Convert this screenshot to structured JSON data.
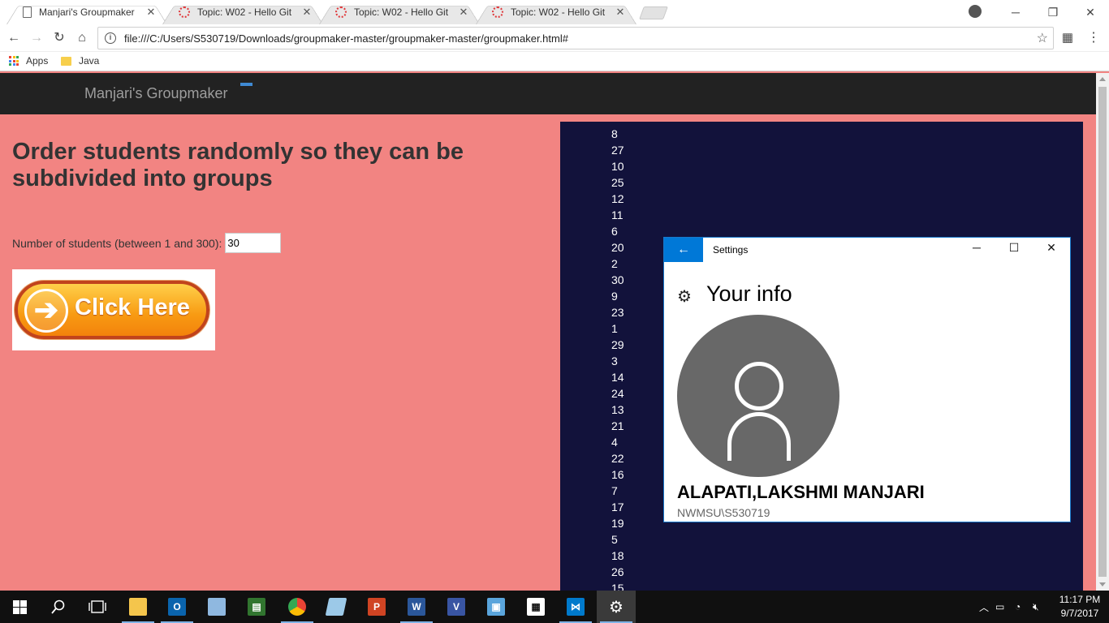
{
  "browser": {
    "tabs": [
      {
        "title": "Manjari's Groupmaker",
        "icon": "document-icon",
        "active": true
      },
      {
        "title": "Topic: W02 - Hello Git",
        "icon": "loading-icon",
        "active": false
      },
      {
        "title": "Topic: W02 - Hello Git",
        "icon": "loading-icon",
        "active": false
      },
      {
        "title": "Topic: W02 - Hello Git",
        "icon": "loading-icon",
        "active": false
      }
    ],
    "address": "file:///C:/Users/S530719/Downloads/groupmaker-master/groupmaker-master/groupmaker.html#",
    "bookmarks": [
      {
        "label": "Apps",
        "icon": "apps-grid-icon"
      },
      {
        "label": "Java",
        "icon": "folder-icon"
      }
    ]
  },
  "page": {
    "brand": "Manjari's Groupmaker",
    "heading": "Order students randomly so they can be subdivided into groups",
    "field_label": "Number of students (between 1 and 300):",
    "field_value": "30",
    "button_label": "Click Here",
    "order": [
      8,
      27,
      10,
      25,
      12,
      11,
      6,
      20,
      2,
      30,
      9,
      23,
      1,
      29,
      3,
      14,
      24,
      13,
      21,
      4,
      22,
      16,
      7,
      17,
      19,
      5,
      18,
      26,
      15
    ]
  },
  "settings": {
    "window_title": "Settings",
    "page_title": "Your info",
    "user_name": "ALAPATI,LAKSHMI MANJARI",
    "account": "NWMSU\\S530719"
  },
  "taskbar": {
    "apps": [
      "start",
      "search",
      "task-view",
      "file-explorer",
      "outlook",
      "app-3d",
      "project",
      "chrome",
      "app-blue",
      "powerpoint",
      "word",
      "visio",
      "app-monitor",
      "calculator",
      "vscode",
      "settings"
    ],
    "time": "11:17 PM",
    "date": "9/7/2017"
  },
  "colors": {
    "page_bg": "#f28482",
    "results_bg": "#12123b",
    "navbar_bg": "#222222",
    "accent": "#0078d7"
  }
}
